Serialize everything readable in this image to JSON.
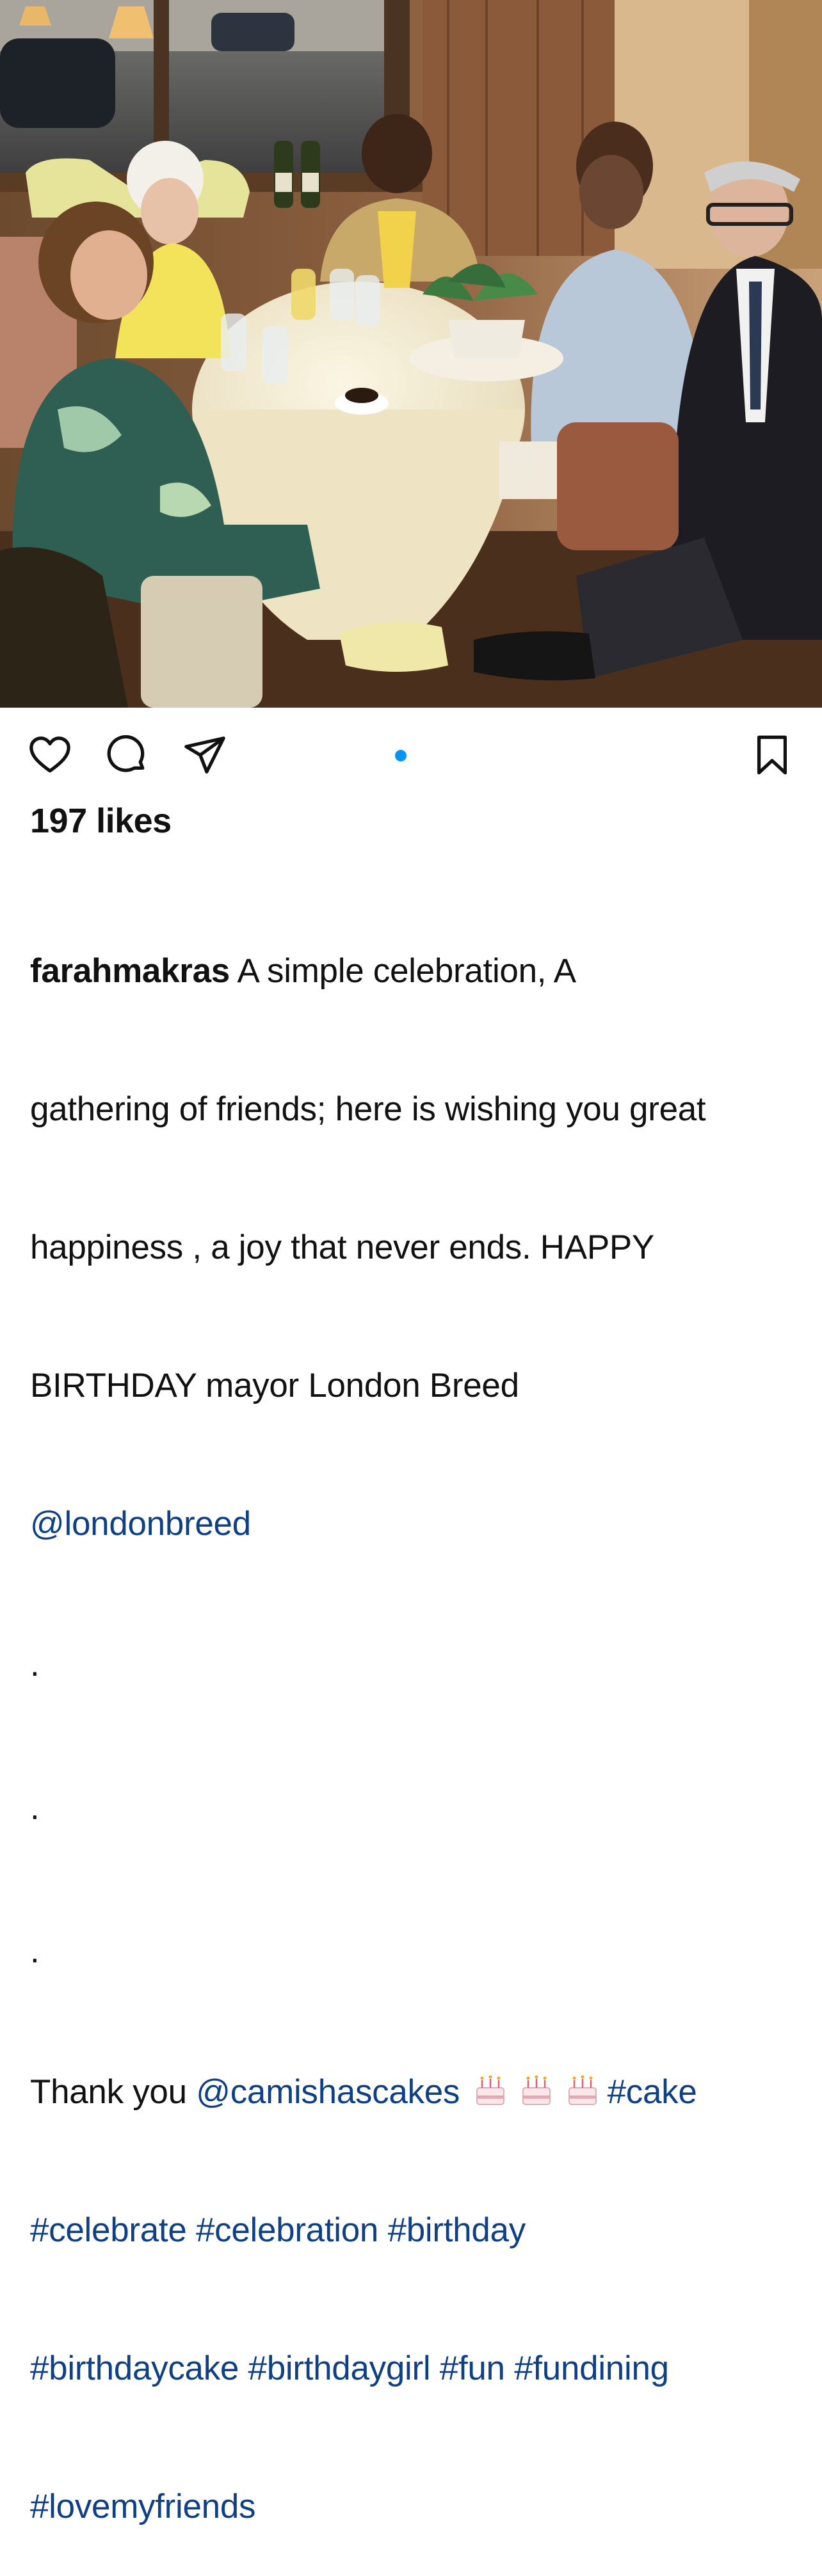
{
  "post": {
    "photo_alt": "Five people seated around a round restaurant table with a potted plant centerpiece",
    "carousel_position": 1,
    "carousel_count": 1
  },
  "actions": {
    "like_icon": "heart-icon",
    "comment_icon": "comment-icon",
    "share_icon": "paper-plane-icon",
    "save_icon": "bookmark-icon"
  },
  "colors": {
    "accent": "#0095f6",
    "link": "#0f3f85",
    "text": "#111111"
  },
  "likes": {
    "text": "197 likes"
  },
  "caption": {
    "username": "farahmakras",
    "line1": " A simple celebration, A",
    "line2": "gathering of friends; here is wishing you great",
    "line3": "happiness , a joy that never ends. HAPPY",
    "line4": "BIRTHDAY mayor London Breed",
    "mention1": "@londonbreed",
    "dot1": ".",
    "dot2": ".",
    "dot3": ".",
    "thanks_prefix": "Thank you ",
    "mention2": "@camishascakes",
    "emoji_name": "birthday-cake-icon",
    "tags": {
      "cake": "#cake",
      "celebrate": "#celebrate",
      "celebration": "#celebration",
      "birthday": "#birthday",
      "birthdaycake": "#birthdaycake",
      "birthdaygirl": "#birthdaygirl",
      "fun": "#fun",
      "fundining": "#fundining",
      "lovemyfriends": "#lovemyfriends"
    }
  }
}
